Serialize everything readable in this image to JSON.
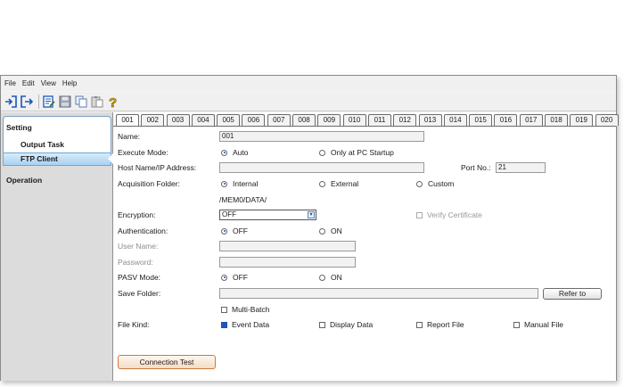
{
  "menu": [
    "File",
    "Edit",
    "View",
    "Help"
  ],
  "toolbar_icons": [
    "login-icon",
    "logout-icon",
    "edit-settings-icon",
    "save-icon",
    "copy-icon",
    "paste-icon",
    "help-icon"
  ],
  "sidebar": {
    "setting_label": "Setting",
    "items": [
      "Output Task",
      "FTP Client"
    ],
    "selected": "FTP Client",
    "operation_label": "Operation"
  },
  "tabs": [
    "001",
    "002",
    "003",
    "004",
    "005",
    "006",
    "007",
    "008",
    "009",
    "010",
    "011",
    "012",
    "013",
    "014",
    "015",
    "016",
    "017",
    "018",
    "019",
    "020"
  ],
  "active_tab": "001",
  "form": {
    "name_label": "Name:",
    "name_value": "001",
    "execute_mode_label": "Execute Mode:",
    "execute_auto": "Auto",
    "execute_startup": "Only at PC Startup",
    "host_label": "Host Name/IP Address:",
    "host_value": "",
    "port_label": "Port No.:",
    "port_value": "21",
    "acq_label": "Acquisition Folder:",
    "acq_internal": "Internal",
    "acq_external": "External",
    "acq_custom": "Custom",
    "acq_path": "/MEM0/DATA/",
    "encryption_label": "Encryption:",
    "encryption_value": "OFF",
    "verify_cert": "Verify Certificate",
    "auth_label": "Authentication:",
    "auth_off": "OFF",
    "auth_on": "ON",
    "user_label": "User Name:",
    "user_value": "",
    "password_label": "Password:",
    "password_value": "",
    "pasv_label": "PASV Mode:",
    "pasv_off": "OFF",
    "pasv_on": "ON",
    "save_folder_label": "Save Folder:",
    "save_folder_value": "",
    "refer_button": "Refer to",
    "multi_batch": "Multi-Batch",
    "file_kind_label": "File Kind:",
    "kind_event": "Event Data",
    "kind_display": "Display Data",
    "kind_report": "Report File",
    "kind_manual": "Manual File",
    "connection_test_button": "Connection Test"
  },
  "colors": {
    "accent": "#1d55b8",
    "selection": "#a9d1f2",
    "orange_button": "#d07a40"
  }
}
